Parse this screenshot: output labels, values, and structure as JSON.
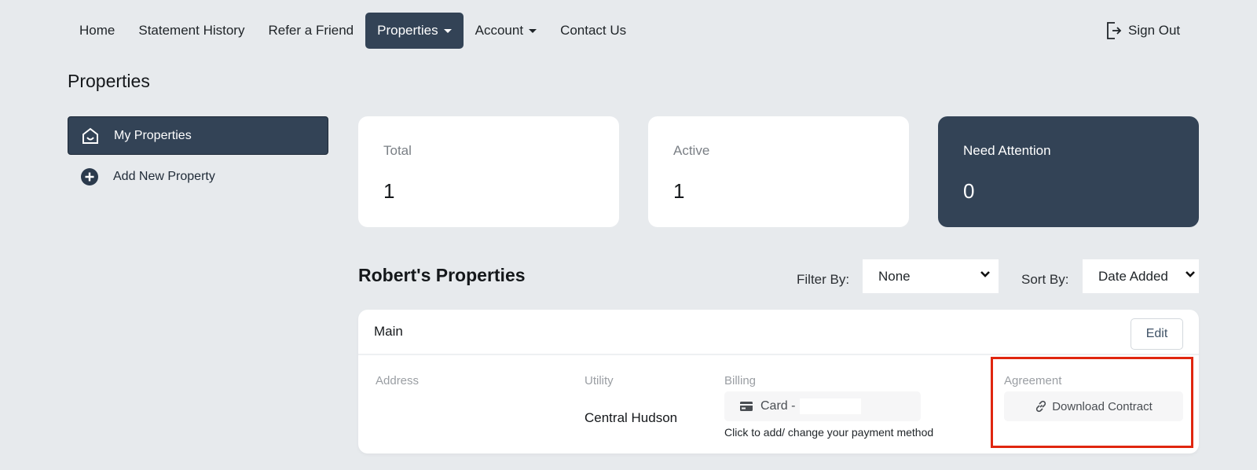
{
  "nav": {
    "items": [
      {
        "label": "Home"
      },
      {
        "label": "Statement History"
      },
      {
        "label": "Refer a Friend"
      },
      {
        "label": "Properties",
        "dropdown": true,
        "active": true
      },
      {
        "label": "Account",
        "dropdown": true
      },
      {
        "label": "Contact Us"
      }
    ],
    "signout_label": "Sign Out"
  },
  "page": {
    "title": "Properties"
  },
  "sidebar": {
    "items": [
      {
        "label": "My Properties",
        "icon": "home-icon",
        "active": true
      },
      {
        "label": "Add New Property",
        "icon": "plus-circle-icon"
      }
    ]
  },
  "stats": [
    {
      "label": "Total",
      "value": "1"
    },
    {
      "label": "Active",
      "value": "1"
    },
    {
      "label": "Need Attention",
      "value": "0"
    }
  ],
  "properties_section": {
    "title": "Robert's Properties",
    "filter_label": "Filter By:",
    "filter_value": "None",
    "sort_label": "Sort By:",
    "sort_value": "Date Added"
  },
  "property": {
    "name": "Main",
    "edit_label": "Edit",
    "address_label": "Address",
    "address_value": "",
    "utility_label": "Utility",
    "utility_value": "Central Hudson",
    "billing_label": "Billing",
    "billing_card_text": "Card -",
    "billing_hint": "Click to add/ change your payment method",
    "agreement_label": "Agreement",
    "download_label": "Download Contract"
  },
  "colors": {
    "accent_dark": "#334356",
    "background": "#e7eaed",
    "highlight": "#e0260f"
  }
}
